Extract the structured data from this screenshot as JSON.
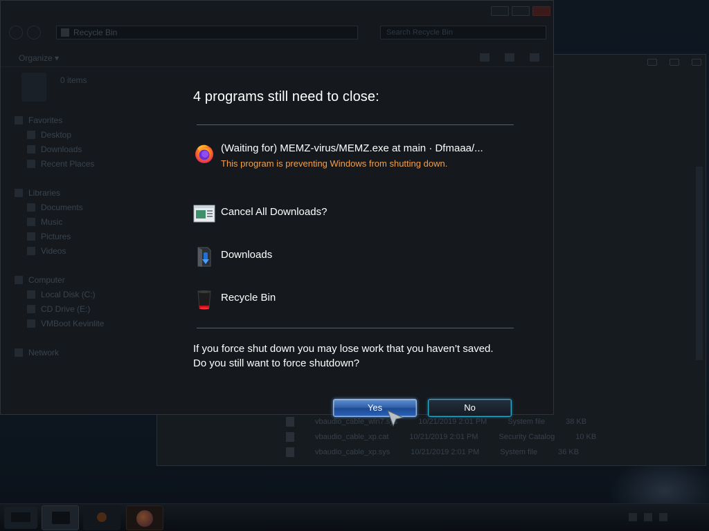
{
  "explorer": {
    "address": "Recycle Bin",
    "search_placeholder": "Search Recycle Bin",
    "organize_label": "Organize ▾",
    "item_count": "0 items",
    "nav": [
      {
        "label": "Favorites",
        "child": false
      },
      {
        "label": "Desktop",
        "child": true
      },
      {
        "label": "Downloads",
        "child": true
      },
      {
        "label": "Recent Places",
        "child": true
      },
      {
        "label": "",
        "gap": true
      },
      {
        "label": "Libraries",
        "child": false
      },
      {
        "label": "Documents",
        "child": true
      },
      {
        "label": "Music",
        "child": true
      },
      {
        "label": "Pictures",
        "child": true
      },
      {
        "label": "Videos",
        "child": true
      },
      {
        "label": "",
        "gap": true
      },
      {
        "label": "Computer",
        "child": false
      },
      {
        "label": "Local Disk (C:)",
        "child": true
      },
      {
        "label": "CD Drive (E:)",
        "child": true
      },
      {
        "label": "VMBoot Kevinlite",
        "child": true
      },
      {
        "label": "",
        "gap": true
      },
      {
        "label": "Network",
        "child": false
      }
    ]
  },
  "back_window": {
    "files": [
      {
        "name": "vbaudio_cable_win7.sys",
        "date": "10/21/2019 2:01 PM",
        "type": "System file",
        "size": "38 KB"
      },
      {
        "name": "vbaudio_cable_xp.cat",
        "date": "10/21/2019 2:01 PM",
        "type": "Security Catalog",
        "size": "10 KB"
      },
      {
        "name": "vbaudio_cable_xp.sys",
        "date": "10/21/2019 2:01 PM",
        "type": "System file",
        "size": "36 KB"
      }
    ]
  },
  "dialog": {
    "title": "4 programs still need to close:",
    "programs": [
      {
        "name": "(Waiting for) MEMZ-virus/MEMZ.exe at main · Dfmaaa/...",
        "status": "This program is preventing Windows from shutting down.",
        "icon": "firefox-icon"
      },
      {
        "name": "Cancel All Downloads?",
        "status": "",
        "icon": "download-dialog-icon"
      },
      {
        "name": "Downloads",
        "status": "",
        "icon": "downloads-folder-icon"
      },
      {
        "name": "Recycle Bin",
        "status": "",
        "icon": "recycle-bin-icon"
      }
    ],
    "warning_line1": "If you force shut down you may lose work that you haven’t saved.",
    "warning_line2": "Do you still want to force shutdown?",
    "yes_label": "Yes",
    "no_label": "No"
  },
  "colors": {
    "status_text": "#f0a050",
    "yes_button": "#2e5fa8",
    "no_button_border": "#2aa9c9",
    "overlay_bg": "#15191e"
  }
}
